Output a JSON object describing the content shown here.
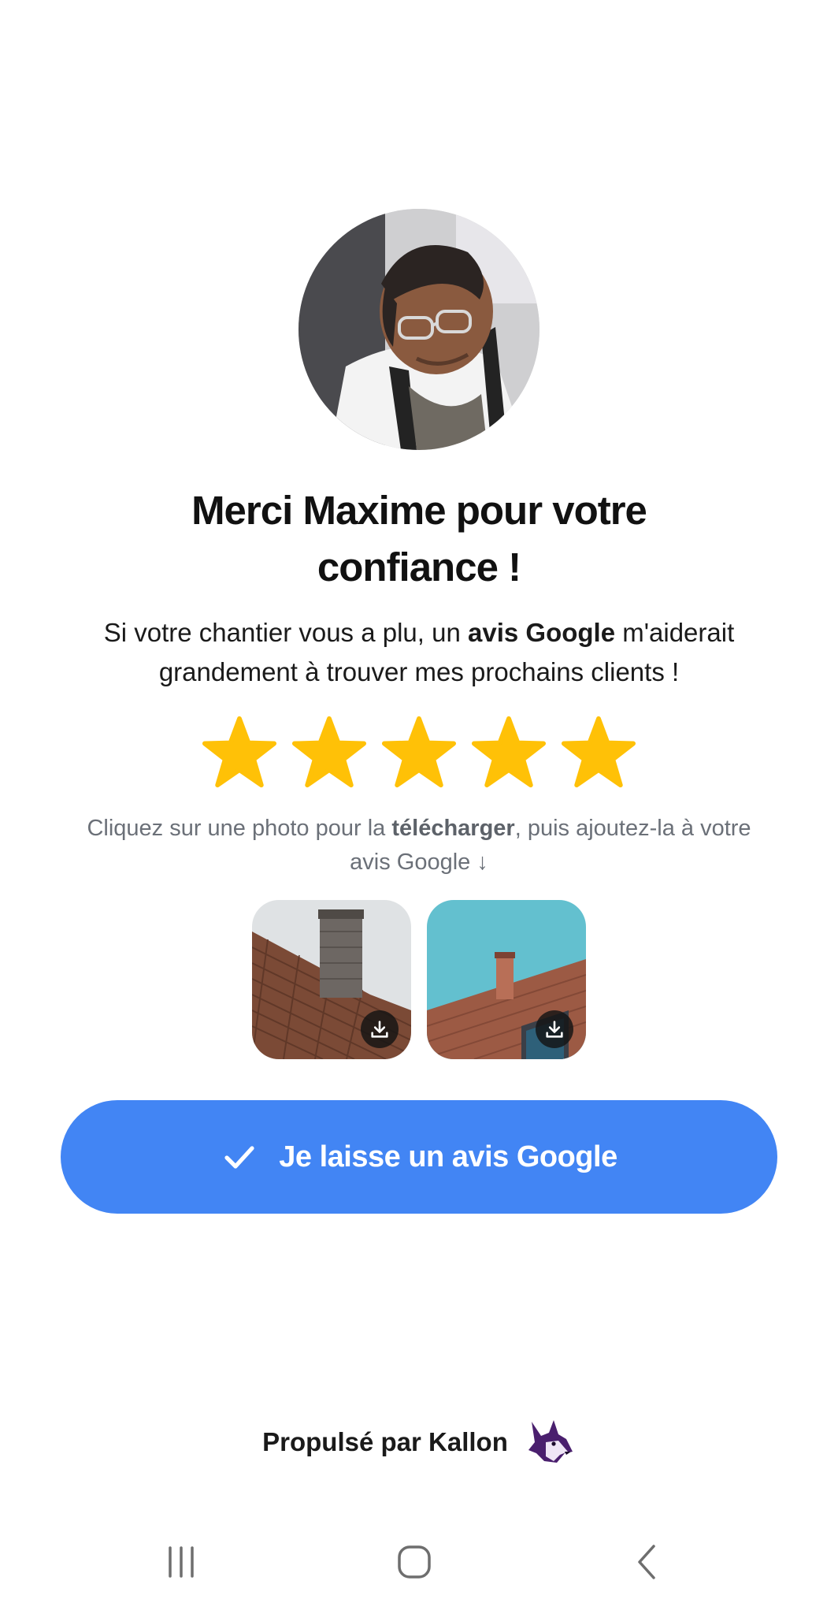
{
  "profile": {
    "avatar_icon": "craftsman-photo"
  },
  "heading": {
    "line1": "Merci Maxime pour votre",
    "line2": "confiance !"
  },
  "message": {
    "part1": "Si votre chantier vous a plu, un ",
    "bold": "avis Google",
    "part2": " m'aiderait",
    "line2": "grandement à trouver mes prochains clients !"
  },
  "rating": {
    "stars": 5,
    "max": 5,
    "color": "#FFC107"
  },
  "instructions": {
    "part1": "Cliquez sur une photo pour la ",
    "bold": "télécharger",
    "part2": ", puis ajoutez-la à votre",
    "line2": "avis Google ↓"
  },
  "photos": [
    {
      "icon": "roof-chimney-photo",
      "action_icon": "download-icon"
    },
    {
      "icon": "roof-sky-photo",
      "action_icon": "download-icon"
    }
  ],
  "cta": {
    "label": "Je laisse un avis Google",
    "icon": "check-icon",
    "color": "#4285F4"
  },
  "footer": {
    "text": "Propulsé par Kallon",
    "logo_icon": "fox-logo-icon"
  },
  "navbar": {
    "recents_icon": "recents-icon",
    "home_icon": "home-icon",
    "back_icon": "back-icon"
  }
}
